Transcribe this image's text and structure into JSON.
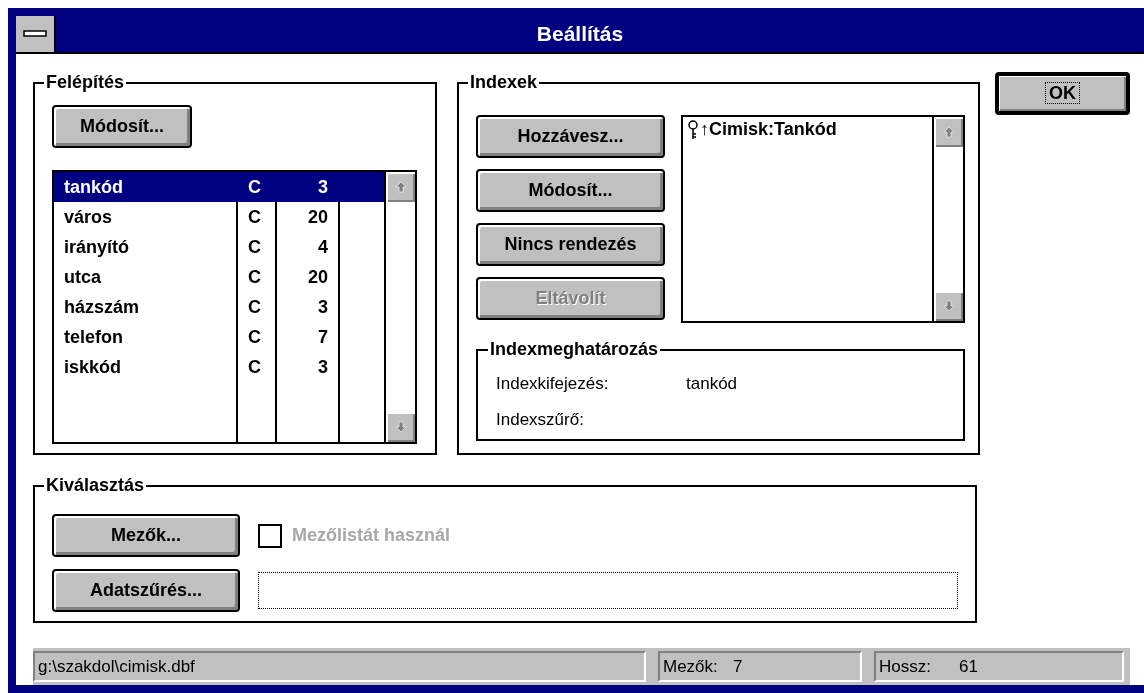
{
  "window": {
    "title": "Beállítás"
  },
  "structure": {
    "title": "Felépítés",
    "modify_button": {
      "label": "Módosít..."
    },
    "fields": [
      {
        "cells": [
          "tankód",
          "C",
          "3"
        ],
        "selected": true
      },
      {
        "cells": [
          "város",
          "C",
          "20"
        ],
        "selected": false
      },
      {
        "cells": [
          "irányító",
          "C",
          "4"
        ],
        "selected": false
      },
      {
        "cells": [
          "utca",
          "C",
          "20"
        ],
        "selected": false
      },
      {
        "cells": [
          "házszám",
          "C",
          "3"
        ],
        "selected": false
      },
      {
        "cells": [
          "telefon",
          "C",
          "7"
        ],
        "selected": false
      },
      {
        "cells": [
          "iskkód",
          "C",
          "3"
        ],
        "selected": false
      }
    ]
  },
  "indexes": {
    "title": "Indexek",
    "buttons": [
      {
        "label": "Hozzávesz...",
        "disabled": false
      },
      {
        "label": "Módosít...",
        "disabled": false
      },
      {
        "label": "Nincs rendezés",
        "disabled": false
      },
      {
        "label": "Eltávolít",
        "disabled": true
      }
    ],
    "index_list": [
      {
        "label": "↑Cimisk:Tankód",
        "selected": false
      }
    ],
    "definition": {
      "title": "Indexmeghatározás",
      "rows": [
        {
          "label": "Indexkifejezés:",
          "value": "tankód"
        },
        {
          "label": "Indexszűrő:"
        }
      ]
    }
  },
  "ok_button": {
    "label": "OK",
    "default": true
  },
  "selection": {
    "title": "Kiválasztás",
    "fields_button": {
      "label": "Mezők..."
    },
    "use_field_list": {
      "label": "Mezőlistát használ",
      "checked": false,
      "disabled": true
    },
    "filter_button": {
      "label": "Adatszűrés..."
    }
  },
  "status_bar": [
    {
      "text": "g:\\szakdol\\cimisk.dbf"
    },
    {
      "text": "Mezők:",
      "value": "7"
    },
    {
      "text": "Hossz:",
      "value": "61"
    }
  ]
}
